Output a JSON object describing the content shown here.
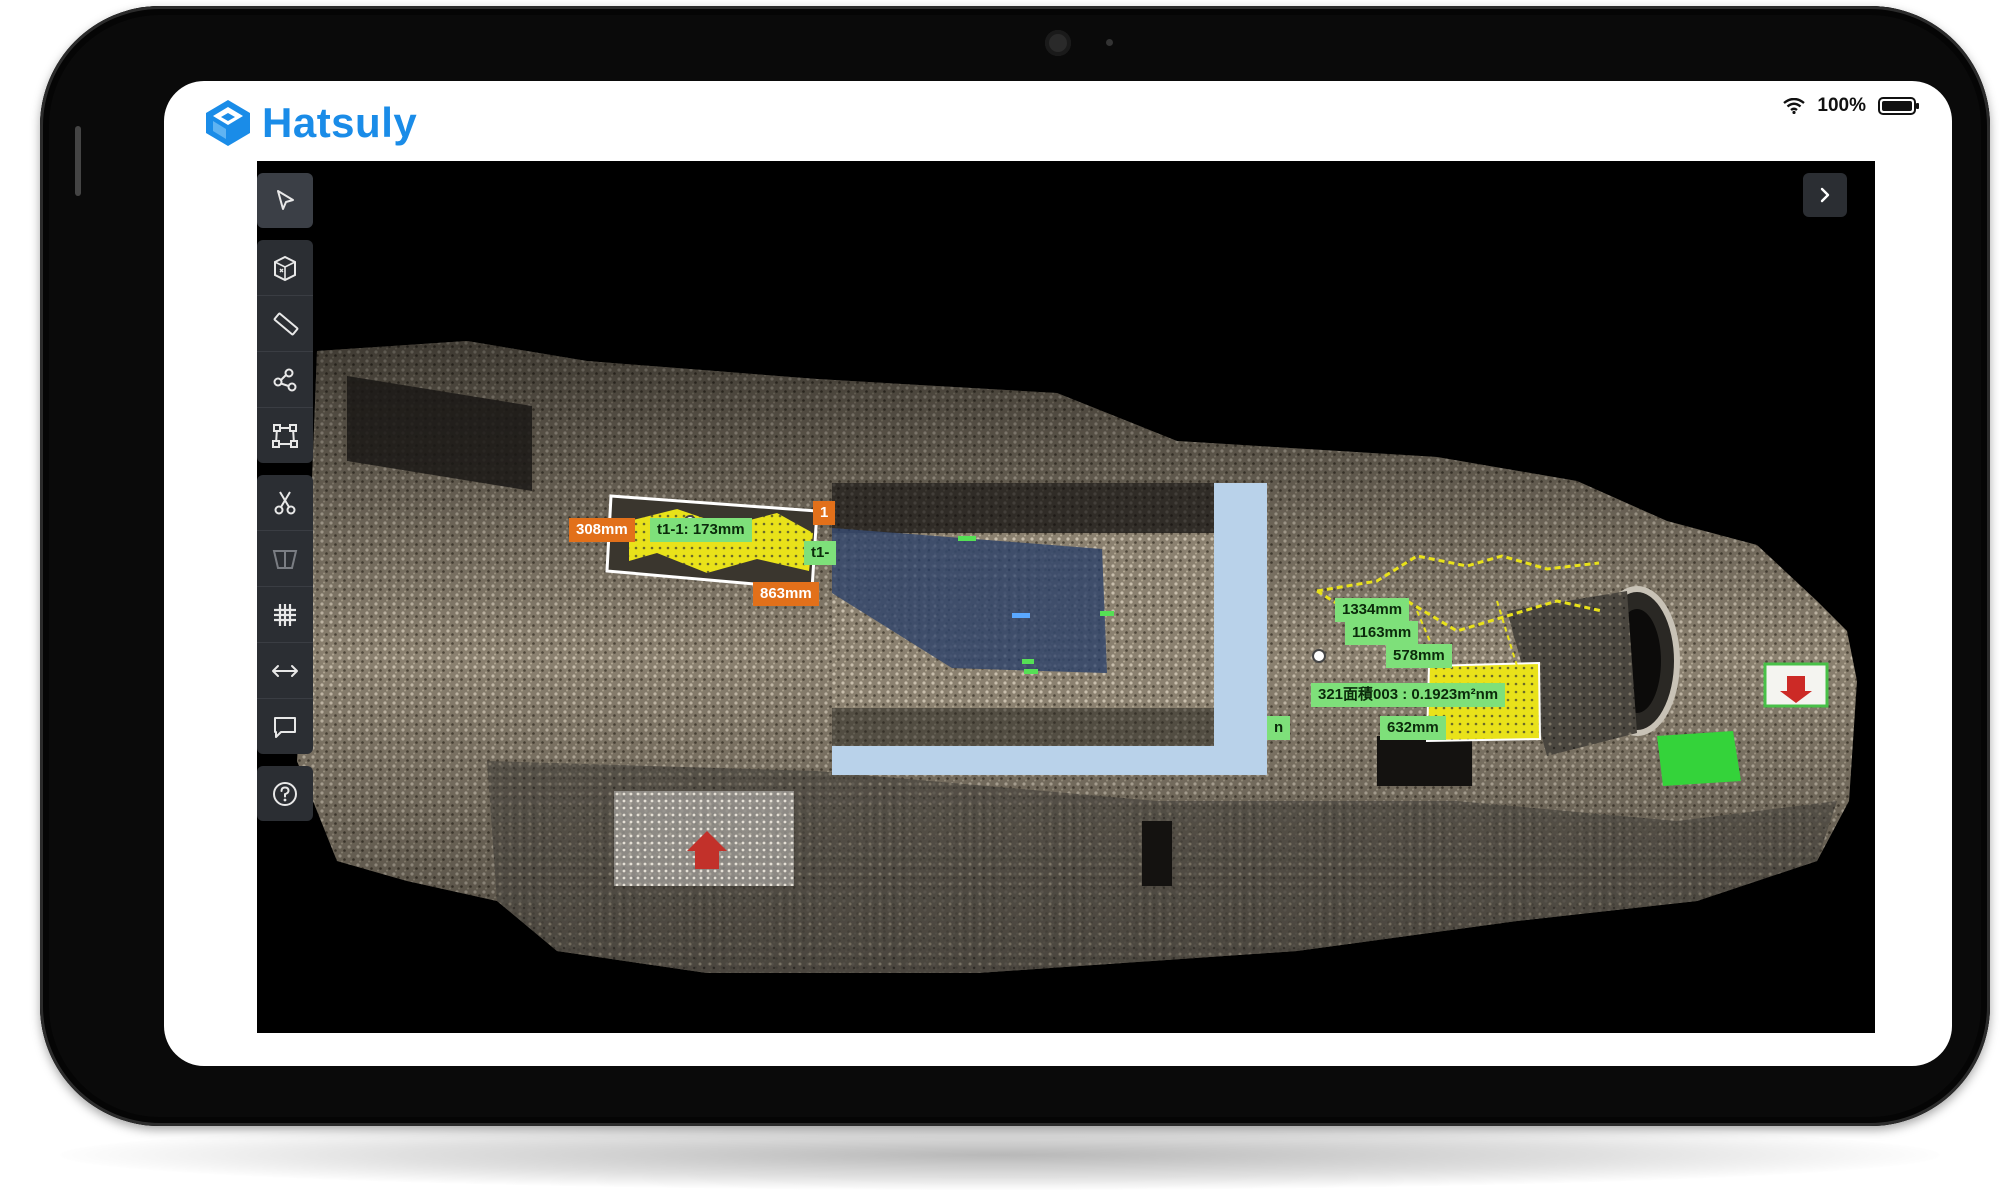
{
  "brand": {
    "name": "Hatsuly",
    "color": "#1a8ce8"
  },
  "status_bar": {
    "battery_text": "100%",
    "icons": [
      "wifi-icon",
      "battery-icon"
    ]
  },
  "viewer": {
    "expand_icon": "chevron-right-icon"
  },
  "toolbar": {
    "groups": [
      [
        "select-pointer-icon"
      ],
      [
        "box-view-icon",
        "ruler-icon",
        "nodes-icon",
        "polygon-icon"
      ],
      [
        "scissors-icon",
        "trapezoid-icon",
        "grid-icon",
        "double-arrow-icon",
        "comment-icon"
      ],
      [
        "help-icon"
      ]
    ]
  },
  "annotations": {
    "a308": "308mm",
    "t1_1": "t1-1: 173mm",
    "t1_partial": "t1-",
    "one_partial": "1",
    "a863": "863mm",
    "a1334": "1334mm",
    "a1163": "1163mm",
    "a578": "578mm",
    "area": "321面積003 : 0.1923m²",
    "area_suffix": "nm",
    "a632": "632mm",
    "m_partial": "n"
  },
  "colors": {
    "label_green": "#7ee07a",
    "label_orange": "#e2701a",
    "label_yellow": "#f2ef2a",
    "marker_green": "#34d33a"
  }
}
